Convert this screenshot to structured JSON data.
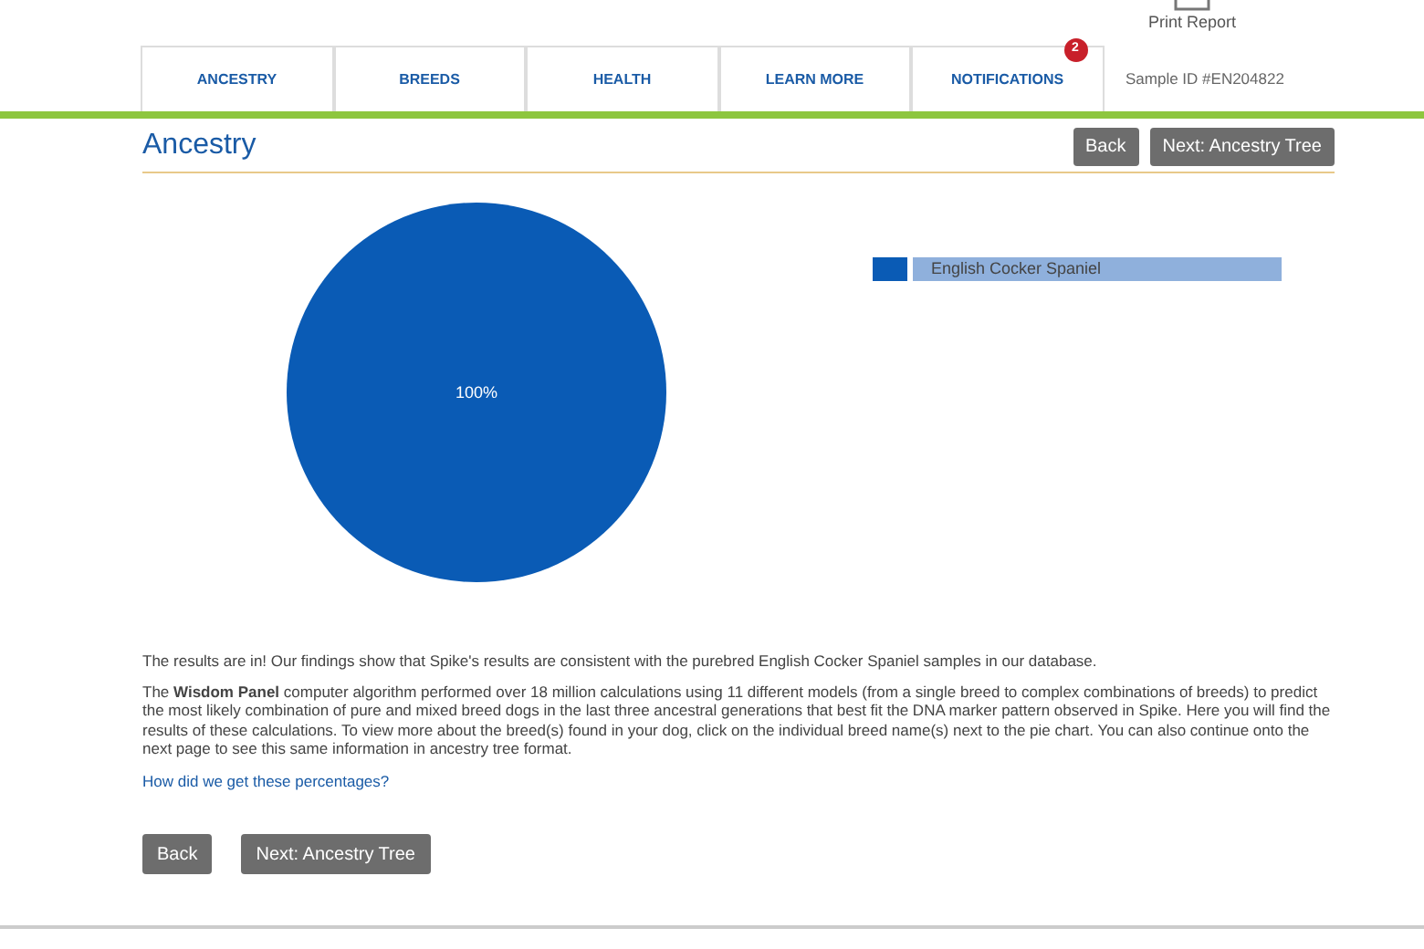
{
  "header": {
    "print_report": "Print Report",
    "sample_id": "Sample ID #EN204822"
  },
  "tabs": [
    {
      "label": "ANCESTRY",
      "selected": false
    },
    {
      "label": "BREEDS",
      "selected": false
    },
    {
      "label": "HEALTH",
      "selected": false
    },
    {
      "label": "LEARN MORE",
      "selected": false
    },
    {
      "label": "NOTIFICATIONS",
      "selected": false,
      "badge": "2"
    }
  ],
  "page_title": "Ancestry",
  "top_buttons": [
    "Back",
    "Next: Ancestry Tree"
  ],
  "chart": {
    "chart_data": {
      "type": "pie",
      "categories": [
        "English Cocker Spaniel"
      ],
      "series": [
        {
          "color": "#0a5bb5",
          "values": [
            100
          ]
        }
      ],
      "value_labels": [
        "100%"
      ]
    }
  },
  "paragraphs": [
    "The results are in! Our findings show that Spike's results are consistent with the purebred English Cocker Spaniel samples in our database.",
    "The **Wisdom Panel** computer algorithm performed over 18 million calculations using 11 different models (from a single breed to complex combinations of breeds) to predict the most likely combination of pure and mixed breed dogs in the last three ancestral generations that best fit the DNA marker pattern observed in Spike. Here you will find the results of these calculations. To view more about the breed(s) found in your dog, click on the individual breed name(s) next to the pie chart. You can also continue onto the next page to see this same information in ancestry tree format."
  ],
  "help_link": "How did we get these percentages?",
  "bottom_buttons": [
    "Back",
    "Next: Ancestry Tree"
  ]
}
